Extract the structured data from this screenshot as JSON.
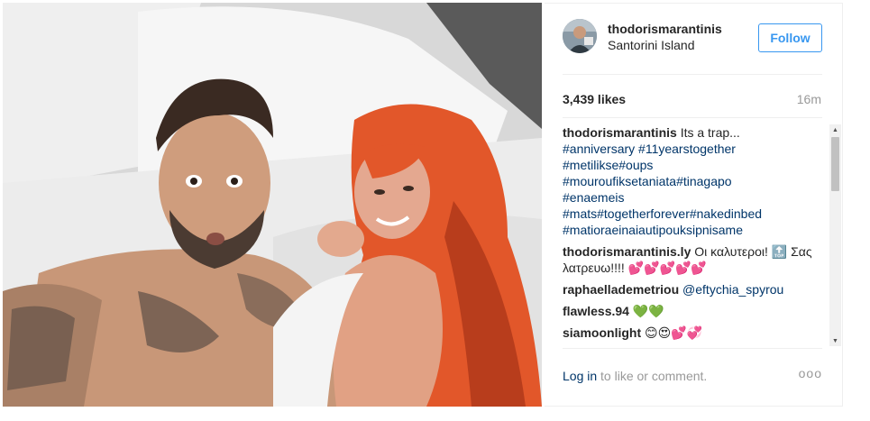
{
  "post": {
    "photo_icon": "photo-image",
    "colors": {
      "link": "#003569",
      "accent": "#3897f0",
      "muted": "#999999"
    }
  },
  "header": {
    "username": "thodorismarantinis",
    "location": "Santorini Island",
    "follow_label": "Follow"
  },
  "stats": {
    "likes": "3,439 likes",
    "time_ago": "16m"
  },
  "comments": [
    {
      "user": "thodorismarantinis",
      "text": "Its a trap...",
      "tags": [
        "#anniversary #11yearstogether",
        "#metilikse#oups",
        "#mouroufiksetaniata#tinagapo",
        "#enaemeis",
        "#mats#togetherforever#nakedinbed",
        "#matioraeinaiautipouksipnisame"
      ]
    },
    {
      "user": "thodorismarantinis.ly",
      "text": "Οι καλυτεροι! 🔝 Σας λατρευω!!!! 💕💕💕💕💕"
    },
    {
      "user": "raphaellademetriou",
      "text": "@eftychia_spyrou"
    },
    {
      "user": "flawless.94",
      "text": "💚💚"
    },
    {
      "user": "siamoonlight",
      "text": "😊😍💕💞"
    }
  ],
  "footer": {
    "login_label": "Log in",
    "prompt": "to like or comment.",
    "more_label": "ooo"
  }
}
